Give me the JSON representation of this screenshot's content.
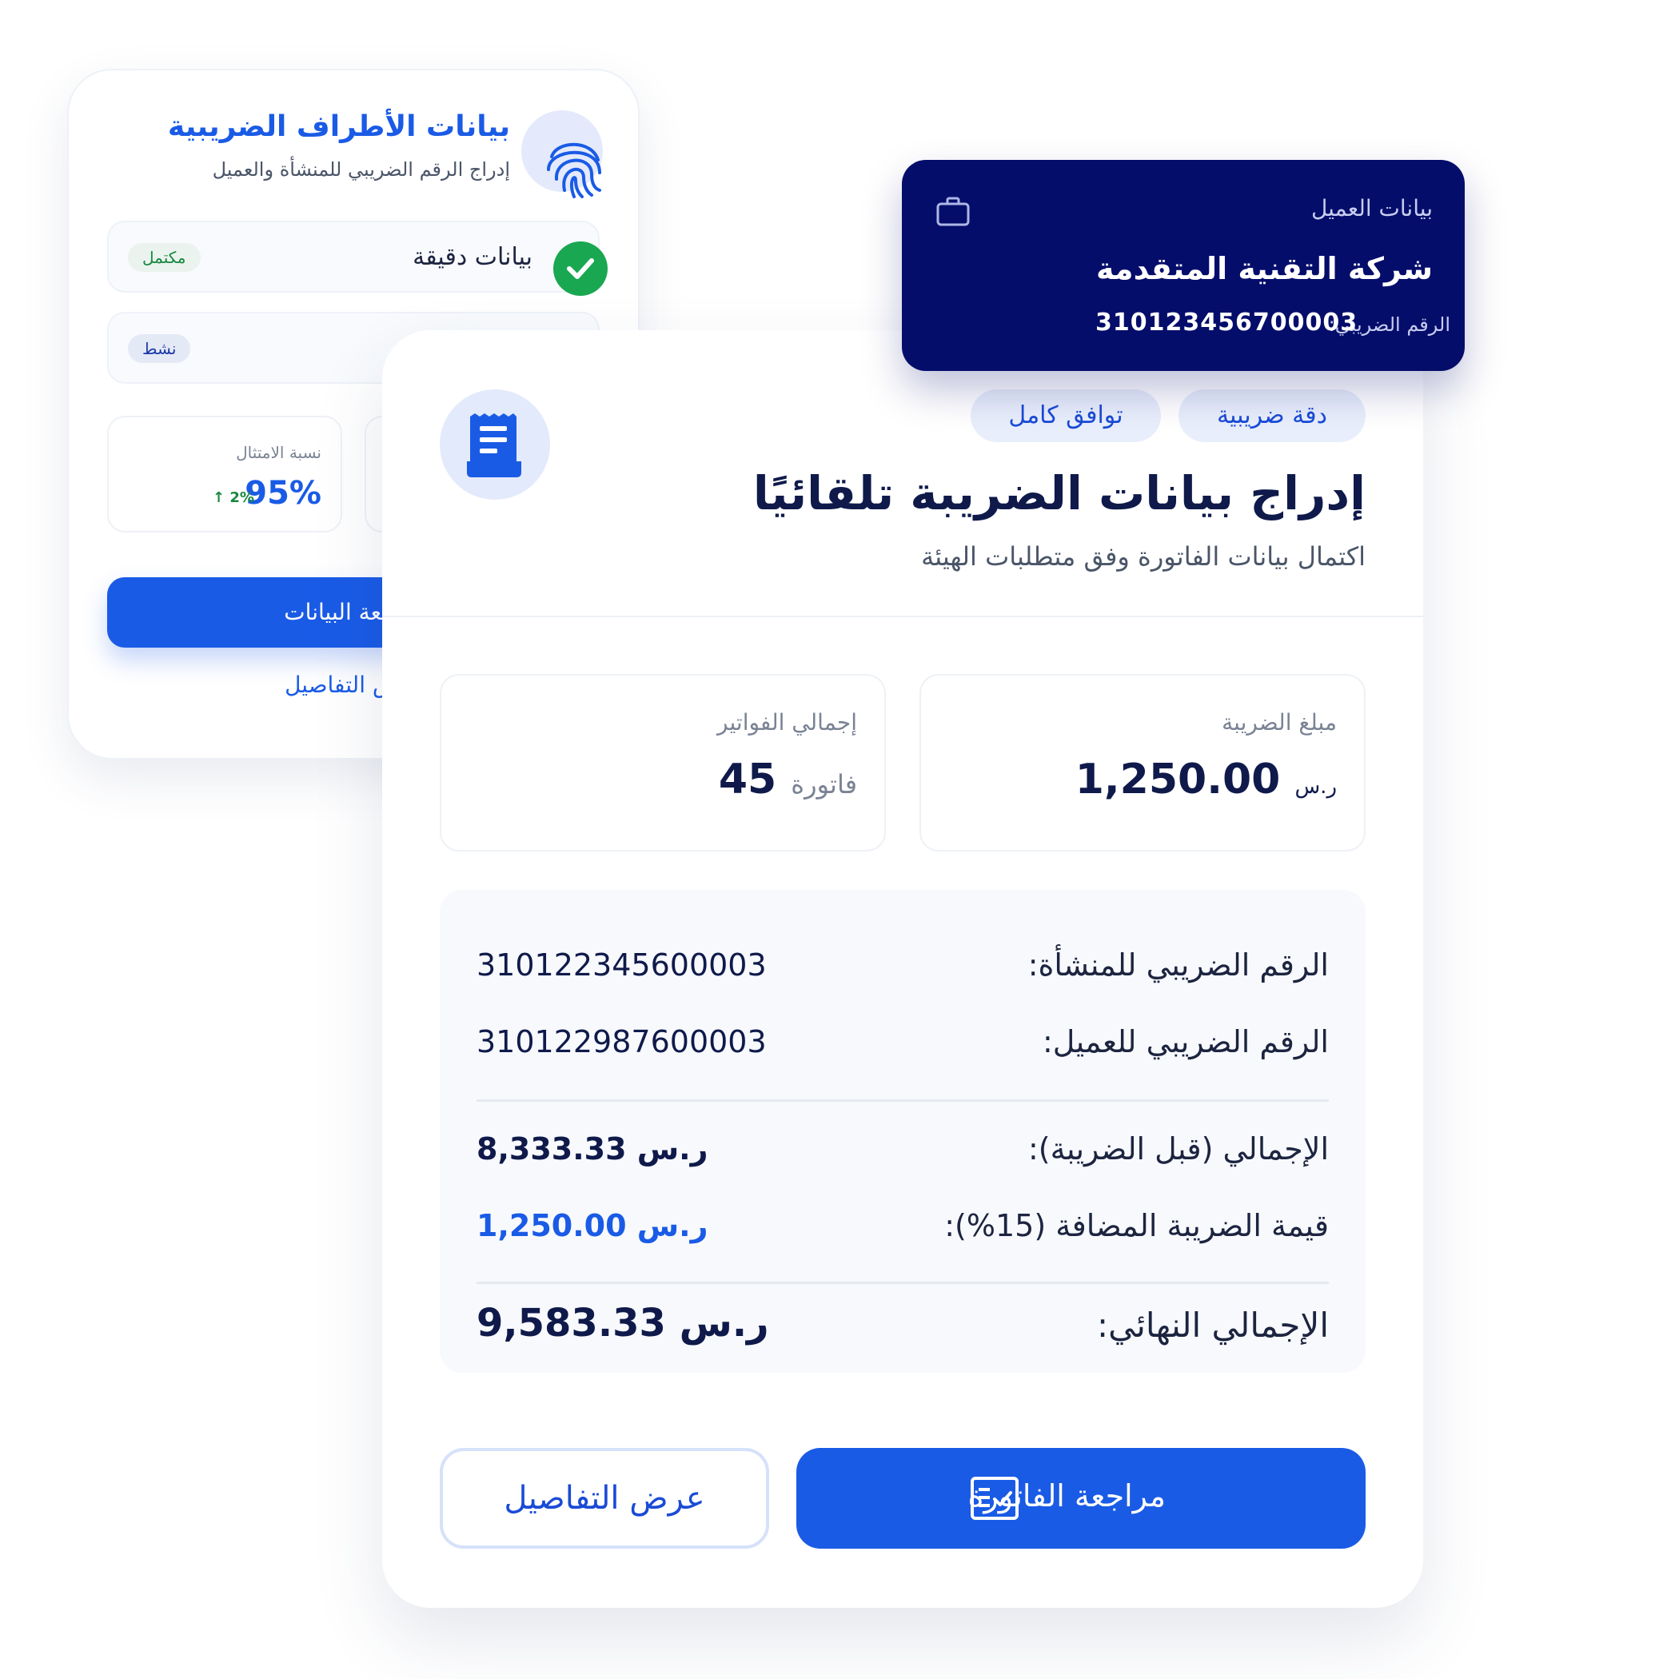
{
  "parties_card": {
    "title": "بيانات الأطراف الضريبية",
    "subtitle": "إدراج الرقم الضريبي للمنشأة والعميل",
    "icon": "fingerprint-icon",
    "rows": [
      {
        "label": "بيانات دقيقة",
        "badge": "مكتمل",
        "icon": "check-circle-icon"
      },
      {
        "label": "",
        "badge": "نشط"
      }
    ],
    "stats": [
      {
        "label": "نسبة الامتثال",
        "value": "95%",
        "trend": "↑ 2%"
      }
    ],
    "primary_button": "مراجعة البيانات",
    "link": "عرض التفاصيل"
  },
  "client_card": {
    "label": "بيانات العميل",
    "company_name": "شركة التقنية المتقدمة",
    "tax_label": "الرقم الضريبي:",
    "tax_number": "310123456700003",
    "icon": "briefcase-icon"
  },
  "main_card": {
    "icon": "receipt-icon",
    "chips": [
      "دقة ضريبية",
      "توافق كامل"
    ],
    "title": "إدراج بيانات الضريبة تلقائيًا",
    "subtitle": "اكتمال بيانات الفاتورة وفق متطلبات الهيئة",
    "stats": {
      "tax_amount": {
        "label": "مبلغ الضريبة",
        "value": "1,250.00",
        "unit": "ر.س"
      },
      "invoices_total": {
        "label": "إجمالي الفواتير",
        "value": "45",
        "unit": "فاتورة"
      }
    },
    "details": [
      {
        "label": "الرقم الضريبي للمنشأة:",
        "value": "310122345600003"
      },
      {
        "label": "الرقم الضريبي للعميل:",
        "value": "310122987600003"
      },
      {
        "label": "الإجمالي (قبل الضريبة):",
        "value": "8,333.33 ر.س"
      },
      {
        "label": "قيمة الضريبة المضافة (15%):",
        "value": "1,250.00 ر.س"
      },
      {
        "label": "الإجمالي النهائي:",
        "value": "9,583.33 ر.س"
      }
    ],
    "primary_button": "مراجعة الفاتورة",
    "secondary_button": "عرض التفاصيل"
  },
  "colors": {
    "accent": "#1a5be6",
    "navy": "#050d6b",
    "success": "#1aa751",
    "text": "#0f1a4b"
  }
}
